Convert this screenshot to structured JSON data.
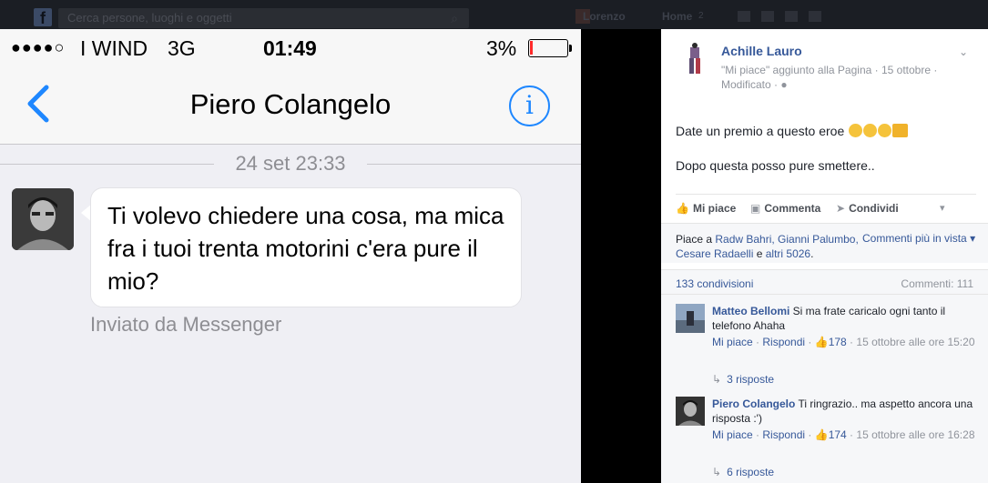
{
  "fb_topbar": {
    "search_placeholder": "Cerca persone, luoghi e oggetti",
    "user_name": "Lorenzo",
    "home_label": "Home",
    "home_count": "2"
  },
  "phone": {
    "status": {
      "signal": "●●●●○",
      "carrier": "I WIND",
      "network": "3G",
      "time": "01:49",
      "battery": "3%"
    },
    "nav": {
      "title": "Piero Colangelo",
      "info_glyph": "i"
    },
    "date_separator": "24 set 23:33",
    "message": {
      "text": "Ti volevo chiedere una cosa, ma mica fra i tuoi trenta motorini c'era pure il mio?",
      "footer": "Inviato da Messenger"
    }
  },
  "post": {
    "author": "Achille Lauro",
    "meta": "\"Mi piace\" aggiunto alla Pagina · 15 ottobre · Modificato ·",
    "text1": "Date un premio a questo eroe ",
    "text2": "Dopo questa posso pure smettere..",
    "actions": {
      "like": "Mi piace",
      "comment": "Commenta",
      "share": "Condividi"
    },
    "likes": {
      "prefix": "Piace a ",
      "names": "Radw Bahri, Gianni Palumbo, Cesare Radaelli",
      "middle": " e ",
      "others": "altri 5026",
      "suffix": ".",
      "order": "Commenti più in vista"
    },
    "shares": "133 condivisioni",
    "comments_count": "Commenti: 111",
    "comments": [
      {
        "name": "Matteo Bellomi",
        "text": " Si ma frate caricalo ogni tanto il telefono Ahaha",
        "like": "Mi piace",
        "reply": "Rispondi",
        "likes": "178",
        "date": "15 ottobre alle ore 15:20",
        "replies": "3 risposte"
      },
      {
        "name": "Piero Colangelo",
        "text": " Ti ringrazio.. ma aspetto ancora una risposta :')",
        "like": "Mi piace",
        "reply": "Rispondi",
        "likes": "174",
        "date": "15 ottobre alle ore 16:28",
        "replies": "6 risposte"
      }
    ]
  }
}
